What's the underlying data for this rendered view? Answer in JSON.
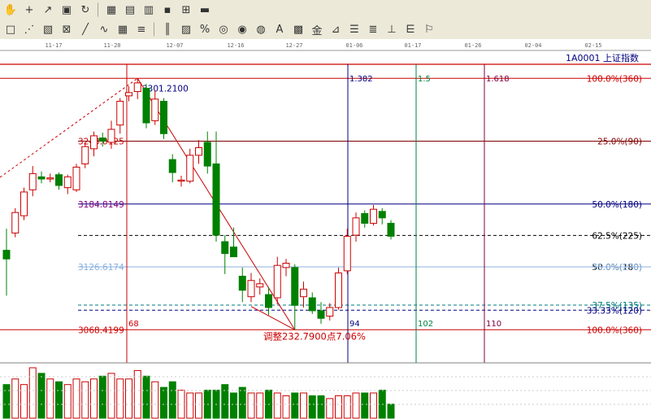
{
  "toolbar_row1": [
    {
      "name": "hand-icon",
      "glyph": "✋"
    },
    {
      "name": "crosshair-icon",
      "glyph": "+"
    },
    {
      "name": "line-draw-icon",
      "glyph": "↗"
    },
    {
      "name": "chart-style-icon",
      "glyph": "▣"
    },
    {
      "name": "refresh-icon",
      "glyph": "↻"
    },
    {
      "name": "sep"
    },
    {
      "name": "calendar-icon",
      "glyph": "▦"
    },
    {
      "name": "calculator-icon",
      "glyph": "▤"
    },
    {
      "name": "document-icon",
      "glyph": "▥"
    },
    {
      "name": "save-icon",
      "glyph": "▪"
    },
    {
      "name": "network-icon",
      "glyph": "⊞"
    },
    {
      "name": "print-icon",
      "glyph": "▬"
    }
  ],
  "toolbar_row2": [
    {
      "name": "rectangle-tool-icon",
      "glyph": "□"
    },
    {
      "name": "fan-lines-icon",
      "glyph": "⋰"
    },
    {
      "name": "box-tool-icon",
      "glyph": "▧"
    },
    {
      "name": "cross-box-icon",
      "glyph": "⊠"
    },
    {
      "name": "trendline-icon",
      "glyph": "╱"
    },
    {
      "name": "zigzag-icon",
      "glyph": "∿"
    },
    {
      "name": "grid-icon",
      "glyph": "▦"
    },
    {
      "name": "parallel-lines-icon",
      "glyph": "≡"
    },
    {
      "name": "sep"
    },
    {
      "name": "period-lines-icon",
      "glyph": "║"
    },
    {
      "name": "percent-tool-icon",
      "glyph": "▨"
    },
    {
      "name": "percent-icon",
      "glyph": "%"
    },
    {
      "name": "ellipse-icon",
      "glyph": "◎"
    },
    {
      "name": "circle-icon",
      "glyph": "◉"
    },
    {
      "name": "arc-icon",
      "glyph": "◍"
    },
    {
      "name": "text-tool-icon",
      "glyph": "A"
    },
    {
      "name": "gann-box-icon",
      "glyph": "▩"
    },
    {
      "name": "gold-icon",
      "glyph": "金"
    },
    {
      "name": "fib-fan-icon",
      "glyph": "⊿"
    },
    {
      "name": "fib-retrace-icon",
      "glyph": "☰"
    },
    {
      "name": "fib-levels-icon",
      "glyph": "≣"
    },
    {
      "name": "time-zone-icon",
      "glyph": "⊥"
    },
    {
      "name": "channel-icon",
      "glyph": "⋿"
    },
    {
      "name": "flag-icon",
      "glyph": "⚐"
    }
  ],
  "header": {
    "symbol_code": "1A0001",
    "symbol_name": "上证指数"
  },
  "date_ticks": [
    "11-17",
    "11-28",
    "12-07",
    "12-16",
    "12-27",
    "01-06",
    "01-17",
    "01-26",
    "02-04",
    "02-15"
  ],
  "chart_data": {
    "type": "candlestick",
    "ylim": [
      3040,
      3315
    ],
    "candles": [
      {
        "o": 3142,
        "h": 3162,
        "l": 3100,
        "c": 3134
      },
      {
        "o": 3158,
        "h": 3181,
        "l": 3154,
        "c": 3177
      },
      {
        "o": 3174,
        "h": 3200,
        "l": 3170,
        "c": 3196
      },
      {
        "o": 3198,
        "h": 3220,
        "l": 3192,
        "c": 3213
      },
      {
        "o": 3210,
        "h": 3215,
        "l": 3204,
        "c": 3208
      },
      {
        "o": 3208,
        "h": 3213,
        "l": 3205,
        "c": 3209
      },
      {
        "o": 3212,
        "h": 3214,
        "l": 3198,
        "c": 3202
      },
      {
        "o": 3200,
        "h": 3212,
        "l": 3194,
        "c": 3210
      },
      {
        "o": 3198,
        "h": 3222,
        "l": 3196,
        "c": 3219
      },
      {
        "o": 3222,
        "h": 3242,
        "l": 3218,
        "c": 3238
      },
      {
        "o": 3236,
        "h": 3252,
        "l": 3229,
        "c": 3248
      },
      {
        "o": 3246,
        "h": 3251,
        "l": 3238,
        "c": 3243
      },
      {
        "o": 3242,
        "h": 3262,
        "l": 3236,
        "c": 3254
      },
      {
        "o": 3258,
        "h": 3283,
        "l": 3250,
        "c": 3280
      },
      {
        "o": 3285,
        "h": 3294,
        "l": 3280,
        "c": 3288
      },
      {
        "o": 3289,
        "h": 3301.21,
        "l": 3282,
        "c": 3297
      },
      {
        "o": 3292,
        "h": 3296,
        "l": 3255,
        "c": 3260
      },
      {
        "o": 3262,
        "h": 3290,
        "l": 3258,
        "c": 3282
      },
      {
        "o": 3280,
        "h": 3283,
        "l": 3245,
        "c": 3250
      },
      {
        "o": 3226,
        "h": 3231,
        "l": 3205,
        "c": 3214
      },
      {
        "o": 3206,
        "h": 3211,
        "l": 3201,
        "c": 3207
      },
      {
        "o": 3206,
        "h": 3236,
        "l": 3204,
        "c": 3230
      },
      {
        "o": 3230,
        "h": 3244,
        "l": 3222,
        "c": 3237
      },
      {
        "o": 3242,
        "h": 3252,
        "l": 3213,
        "c": 3220
      },
      {
        "o": 3222,
        "h": 3252,
        "l": 3150,
        "c": 3156
      },
      {
        "o": 3150,
        "h": 3156,
        "l": 3120,
        "c": 3139
      },
      {
        "o": 3145,
        "h": 3163,
        "l": 3140,
        "c": 3136
      },
      {
        "o": 3118,
        "h": 3126,
        "l": 3094,
        "c": 3105
      },
      {
        "o": 3099,
        "h": 3121,
        "l": 3094,
        "c": 3114
      },
      {
        "o": 3108,
        "h": 3116,
        "l": 3101,
        "c": 3111
      },
      {
        "o": 3101,
        "h": 3108,
        "l": 3082,
        "c": 3089
      },
      {
        "o": 3098,
        "h": 3136,
        "l": 3092,
        "c": 3128
      },
      {
        "o": 3126,
        "h": 3134,
        "l": 3118,
        "c": 3130
      },
      {
        "o": 3126,
        "h": 3129,
        "l": 3068.42,
        "c": 3091
      },
      {
        "o": 3099,
        "h": 3113,
        "l": 3089,
        "c": 3106
      },
      {
        "o": 3098,
        "h": 3103,
        "l": 3083,
        "c": 3086
      },
      {
        "o": 3086,
        "h": 3094,
        "l": 3074,
        "c": 3079
      },
      {
        "o": 3081,
        "h": 3093,
        "l": 3077,
        "c": 3089
      },
      {
        "o": 3089,
        "h": 3126,
        "l": 3087,
        "c": 3121
      },
      {
        "o": 3123,
        "h": 3162,
        "l": 3120,
        "c": 3155
      },
      {
        "o": 3156,
        "h": 3177,
        "l": 3150,
        "c": 3172
      },
      {
        "o": 3176,
        "h": 3179,
        "l": 3163,
        "c": 3167
      },
      {
        "o": 3167,
        "h": 3184,
        "l": 3165,
        "c": 3180
      },
      {
        "o": 3178,
        "h": 3181,
        "l": 3166,
        "c": 3172
      },
      {
        "o": 3167,
        "h": 3170,
        "l": 3152,
        "c": 3155
      }
    ],
    "volumes": [
      12,
      14,
      12,
      18,
      16,
      14,
      13,
      12,
      14,
      13,
      14,
      15,
      16,
      14,
      14,
      17,
      15,
      13,
      11,
      13,
      10,
      9,
      9,
      10,
      10,
      12,
      9,
      11,
      9,
      9,
      10,
      9,
      8,
      9,
      9,
      8,
      8,
      7,
      8,
      8,
      9,
      9,
      9,
      10,
      5
    ],
    "fib_price_levels": [
      {
        "label": "100.0%(360)",
        "price": 3301.21,
        "color": "#cc0000"
      },
      {
        "label": "25.0%(90)",
        "price": 3243.01,
        "color": "#800000"
      },
      {
        "label": "50.0%(180)",
        "price": 3184.81,
        "color": "#000080"
      },
      {
        "label": "62.5%(225)",
        "price": 3155.72,
        "color": "#000000",
        "dashed": true
      },
      {
        "label": "50.0%(180)",
        "price": 3126.62,
        "color": "#000000",
        "dashed": true
      },
      {
        "label": "75.0%(270)",
        "price": 3126.62,
        "color": "#88b0e0"
      },
      {
        "label": "37.5%(135)",
        "price": 3091.26,
        "color": "#007a7a",
        "dashed": true
      },
      {
        "label": "33.33%(120)",
        "price": 3086.5,
        "color": "#000080",
        "dashed": true
      },
      {
        "label": "100.0%(360)",
        "price": 3068.42,
        "color": "#cc0000"
      }
    ],
    "price_labels": [
      {
        "text": "3301.2100",
        "price": 3301.21,
        "color": "#000080"
      },
      {
        "text": "3243.0125",
        "price": 3243.01,
        "color": "#cc0000"
      },
      {
        "text": "3184.8149",
        "price": 3184.81,
        "color": "#800080"
      },
      {
        "text": "3126.6174",
        "price": 3126.62,
        "color": "#88b0e0"
      },
      {
        "text": "3068.4199",
        "price": 3068.42,
        "color": "#cc0000"
      }
    ],
    "annotation": "调整232.7900点7.06%",
    "time_ratio_lines": [
      {
        "label": "1.382",
        "count": "94",
        "color": "#000080"
      },
      {
        "label": "1.5",
        "count": "102",
        "color": "#008040"
      },
      {
        "label": "1.618",
        "count": "110",
        "color": "#800040"
      }
    ],
    "start_count_label": "68",
    "colors": {
      "up": "#cc0000",
      "down": "#008000",
      "grid": "#e0e0e0"
    }
  }
}
